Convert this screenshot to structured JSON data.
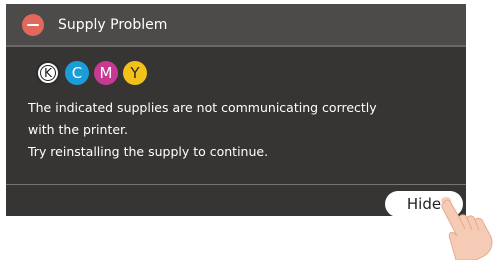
{
  "dialog": {
    "title": "Supply Problem",
    "icon": "error-minus-icon",
    "supplies": [
      {
        "letter": "K",
        "name": "black",
        "color": "#ffffff"
      },
      {
        "letter": "C",
        "name": "cyan",
        "color": "#1a9ed9"
      },
      {
        "letter": "M",
        "name": "magenta",
        "color": "#c63b91"
      },
      {
        "letter": "Y",
        "name": "yellow",
        "color": "#f2c21a"
      }
    ],
    "message_lines": [
      "The indicated supplies are not communicating correctly",
      "with the printer.",
      "Try reinstalling the supply to continue."
    ],
    "hide_label": "Hide"
  },
  "colors": {
    "panel": "#373534",
    "title_bar": "#4d4b49",
    "error": "#e2685c"
  }
}
